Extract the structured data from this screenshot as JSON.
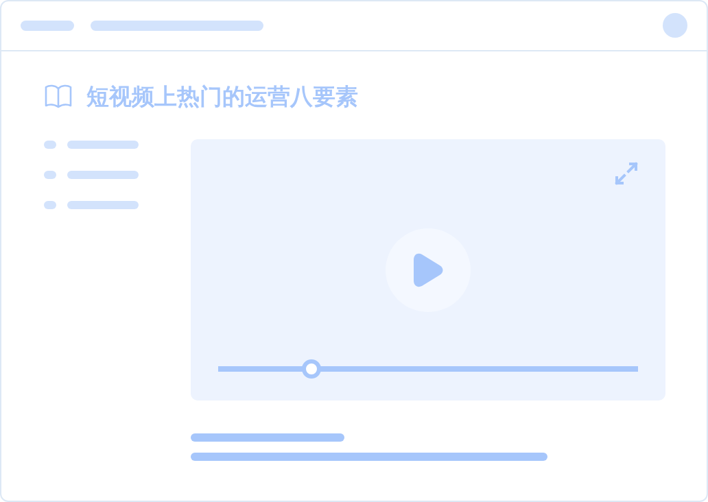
{
  "title": "短视频上热门的运营八要素",
  "video": {
    "progress": {
      "level": 0.222
    }
  }
}
